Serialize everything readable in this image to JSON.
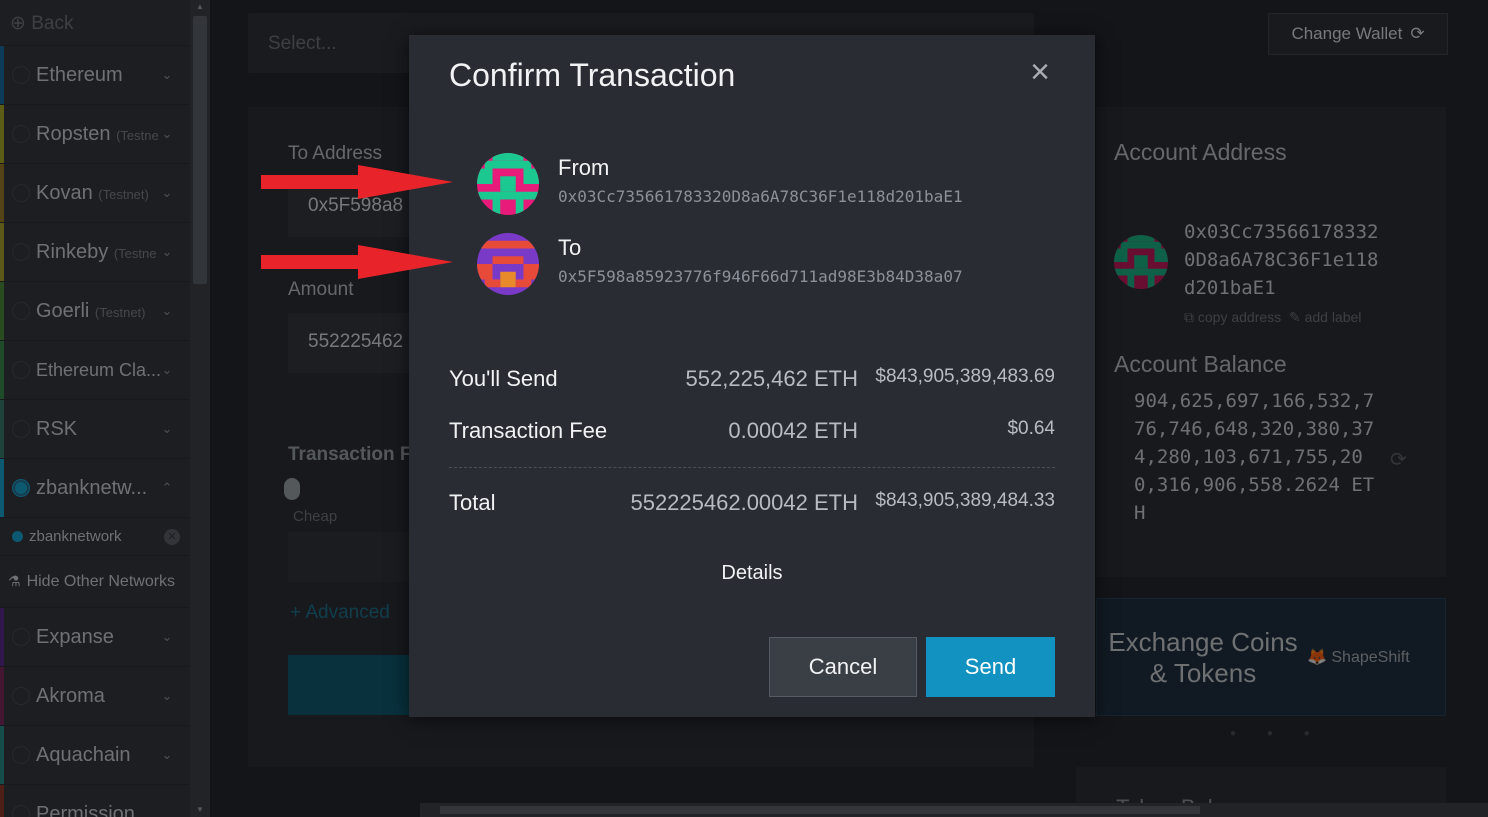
{
  "sidebar": {
    "back_label": "Back",
    "networks": [
      {
        "name": "Ethereum",
        "sub": "",
        "color": "#1a6ea0"
      },
      {
        "name": "Ropsten",
        "sub": "(Testne",
        "color": "#a8a82a"
      },
      {
        "name": "Kovan",
        "sub": "(Testnet)",
        "color": "#9a7a2a"
      },
      {
        "name": "Rinkeby",
        "sub": "(Testne",
        "color": "#a8a030"
      },
      {
        "name": "Goerli",
        "sub": "(Testnet)",
        "color": "#4a8a3a"
      },
      {
        "name": "Ethereum Cla...",
        "sub": "",
        "color": "#3a8a4a"
      },
      {
        "name": "RSK",
        "sub": "",
        "color": "#3a7a6a"
      }
    ],
    "custom_network": {
      "name": "zbanknetw...",
      "color": "#1aa3d0"
    },
    "custom_sub": "zbanknetwork",
    "hide_other": "Hide Other Networks",
    "more_networks": [
      {
        "name": "Expanse",
        "color": "#5a2a8a"
      },
      {
        "name": "Akroma",
        "color": "#7a2a5a"
      },
      {
        "name": "Aquachain",
        "color": "#2a8a8a"
      },
      {
        "name": "Permission",
        "color": "#8a3a2a"
      }
    ]
  },
  "background": {
    "select_placeholder": "Select...",
    "change_wallet": "Change Wallet",
    "to_address_label": "To Address",
    "to_address_value": "0x5F598a8",
    "amount_label": "Amount",
    "amount_value": "552225462",
    "fee_label": "Transaction Fe",
    "cheap_label": "Cheap",
    "advanced_label": "+ Advanced",
    "account_address_title": "Account Address",
    "account_address": "0x03Cc735661783320D8a6A78C36F1e118d201baE1",
    "copy_address": "copy address",
    "add_label": "add label",
    "account_balance_title": "Account Balance",
    "account_balance": "904,625,697,166,532,776,746,648,320,380,374,280,103,671,755,200,316,906,558.2624 ETH",
    "exchange_title": "Exchange Coins & Tokens",
    "shapeshift": "ShapeShift",
    "token_title": "Token Bal..."
  },
  "modal": {
    "title": "Confirm Transaction",
    "from_label": "From",
    "from_address": "0x03Cc735661783320D8a6A78C36F1e118d201baE1",
    "to_label": "To",
    "to_address": "0x5F598a85923776f946F66d711ad98E3b84D38a07",
    "rows": [
      {
        "label": "You'll Send",
        "eth": "552,225,462 ETH",
        "usd": "$843,905,389,483.69"
      },
      {
        "label": "Transaction Fee",
        "eth": "0.00042 ETH",
        "usd": "$0.64"
      },
      {
        "label": "Total",
        "eth": "552225462.00042 ETH",
        "usd": "$843,905,389,484.33"
      }
    ],
    "details_label": "Details",
    "cancel_label": "Cancel",
    "send_label": "Send"
  },
  "colors": {
    "accent": "#1192c0",
    "annotation_arrow": "#e8242a"
  }
}
